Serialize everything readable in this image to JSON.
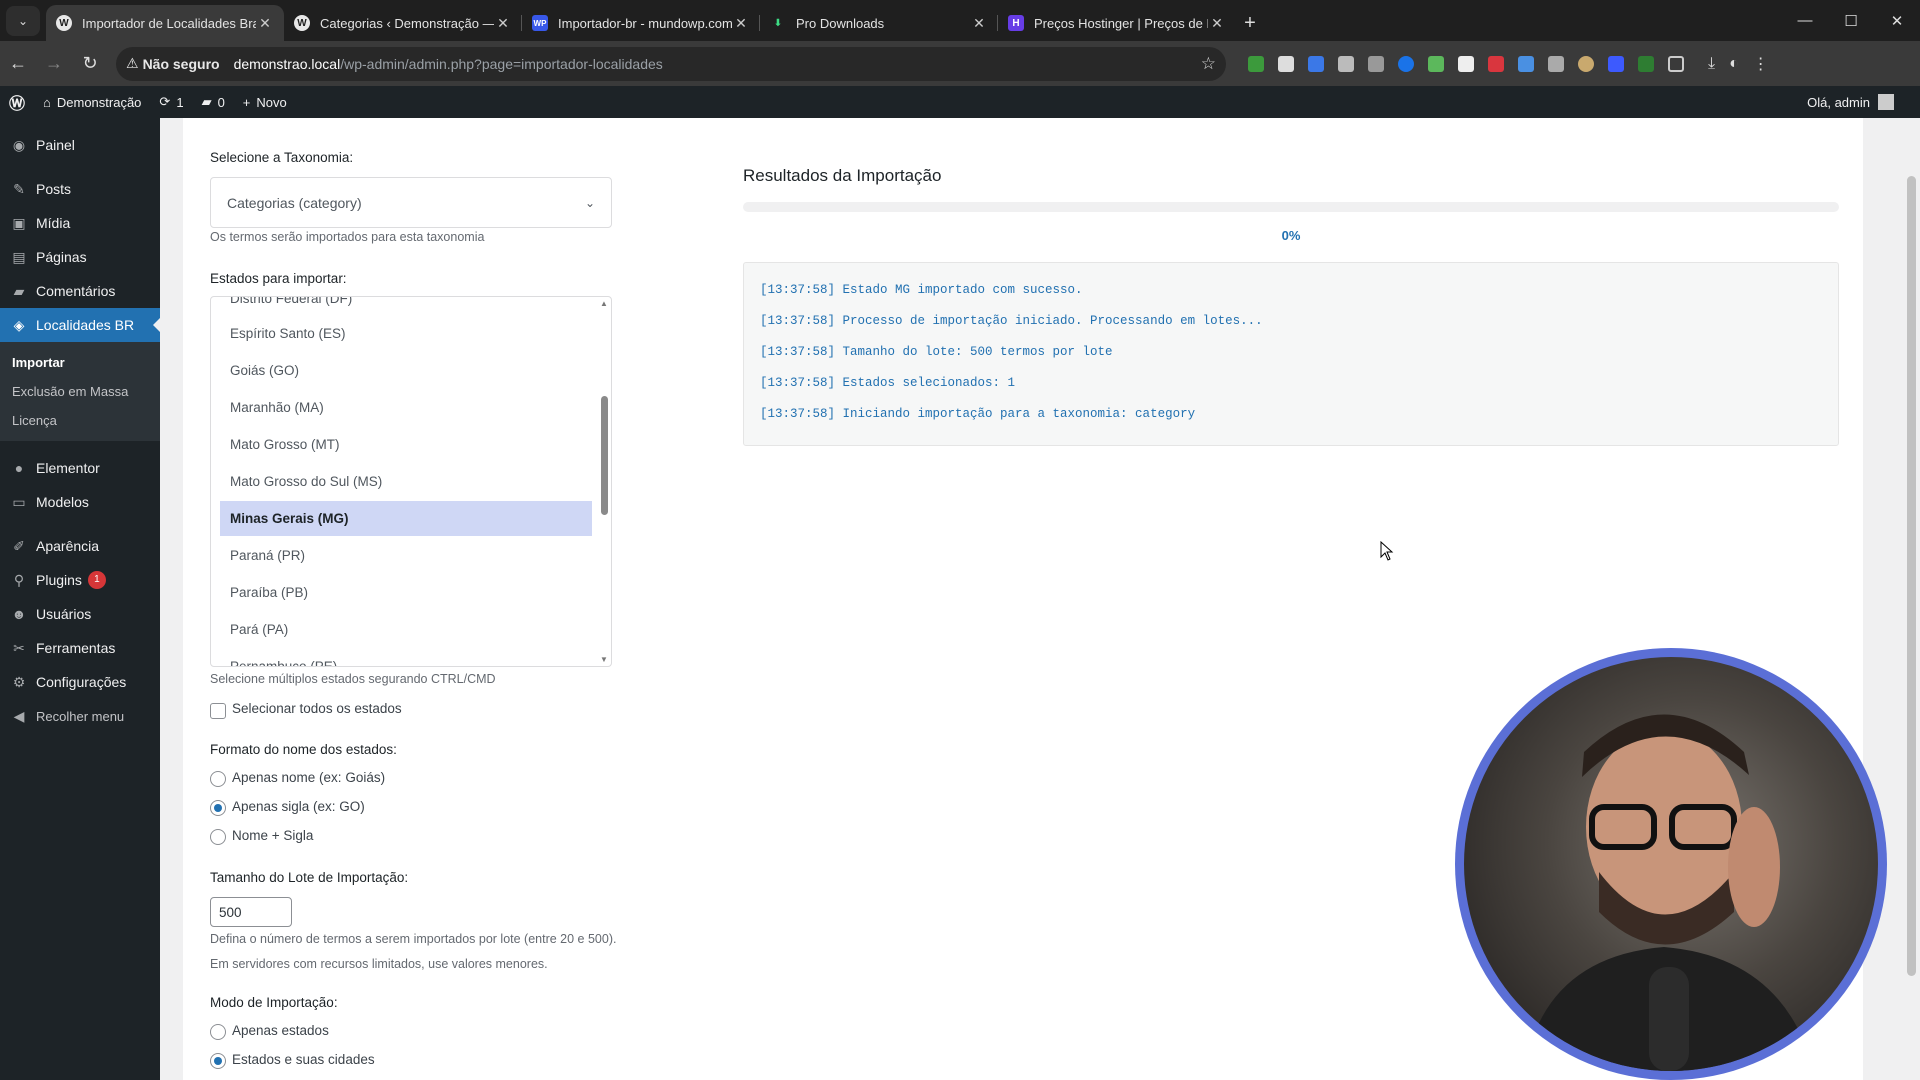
{
  "browser": {
    "tabs": [
      {
        "title": "Importador de Localidades Bra",
        "active": true,
        "favicon": "wordpress-icon"
      },
      {
        "title": "Categorias ‹ Demonstração — W",
        "active": false,
        "favicon": "wordpress-icon"
      },
      {
        "title": "Importador-br - mundowp.com",
        "active": false,
        "favicon": "wp-icon"
      },
      {
        "title": "Pro Downloads",
        "active": false,
        "favicon": "download-icon"
      },
      {
        "title": "Preços Hostinger | Preços de H",
        "active": false,
        "favicon": "hostinger-icon"
      }
    ],
    "security_label": "Não seguro",
    "url_host": "demonstrao.local",
    "url_path": "/wp-admin/admin.php?page=importador-localidades"
  },
  "adminbar": {
    "site_name": "Demonstração",
    "updates_count": "1",
    "comments_count": "0",
    "new_label": "Novo",
    "greeting": "Olá, admin"
  },
  "sidebar": {
    "items": [
      {
        "label": "Painel",
        "icon": "dashboard-icon"
      },
      {
        "label": "Posts",
        "icon": "pin-icon"
      },
      {
        "label": "Mídia",
        "icon": "media-icon"
      },
      {
        "label": "Páginas",
        "icon": "pages-icon"
      },
      {
        "label": "Comentários",
        "icon": "comment-icon"
      },
      {
        "label": "Localidades BR",
        "icon": "location-icon"
      },
      {
        "label": "Elementor",
        "icon": "elementor-icon"
      },
      {
        "label": "Modelos",
        "icon": "folder-icon"
      },
      {
        "label": "Aparência",
        "icon": "brush-icon"
      },
      {
        "label": "Plugins",
        "icon": "plugin-icon"
      },
      {
        "label": "Usuários",
        "icon": "user-icon"
      },
      {
        "label": "Ferramentas",
        "icon": "wrench-icon"
      },
      {
        "label": "Configurações",
        "icon": "settings-icon"
      },
      {
        "label": "Recolher menu",
        "icon": "collapse-icon"
      }
    ],
    "submenu": [
      "Importar",
      "Exclusão em Massa",
      "Licença"
    ],
    "plugins_badge": "1"
  },
  "form": {
    "taxonomy_label": "Selecione a Taxonomia:",
    "taxonomy_value": "Categorias (category)",
    "taxonomy_desc": "Os termos serão importados para esta taxonomia",
    "states_label": "Estados para importar:",
    "states": [
      "Distrito Federal (DF)",
      "Espírito Santo (ES)",
      "Goiás (GO)",
      "Maranhão (MA)",
      "Mato Grosso (MT)",
      "Mato Grosso do Sul (MS)",
      "Minas Gerais (MG)",
      "Paraná (PR)",
      "Paraíba (PB)",
      "Pará (PA)",
      "Pernambuco (PE)"
    ],
    "selected_state": "Minas Gerais (MG)",
    "states_desc": "Selecione múltiplos estados segurando CTRL/CMD",
    "select_all_label": "Selecionar todos os estados",
    "name_format_label": "Formato do nome dos estados:",
    "name_format_options": [
      "Apenas nome (ex: Goiás)",
      "Apenas sigla (ex: GO)",
      "Nome + Sigla"
    ],
    "name_format_selected": 1,
    "batch_label": "Tamanho do Lote de Importação:",
    "batch_value": "500",
    "batch_desc_1": "Defina o número de termos a serem importados por lote (entre 20 e 500).",
    "batch_desc_2": "Em servidores com recursos limitados, use valores menores.",
    "mode_label": "Modo de Importação:",
    "mode_options": [
      "Apenas estados",
      "Estados e suas cidades"
    ],
    "mode_selected": 1
  },
  "results": {
    "title": "Resultados da Importação",
    "progress_percent": "0%",
    "progress_value": 0,
    "log": [
      "[13:37:58] Estado MG importado com sucesso.",
      "[13:37:58] Processo de importação iniciado. Processando em lotes...",
      "[13:37:58] Tamanho do lote: 500 termos por lote",
      "[13:37:58] Estados selecionados: 1",
      "[13:37:58] Iniciando importação para a taxonomia: category"
    ]
  },
  "colors": {
    "wp_blue": "#2271b1",
    "admin_dark": "#1d2327",
    "webcam_ring": "#5b6fd6"
  }
}
